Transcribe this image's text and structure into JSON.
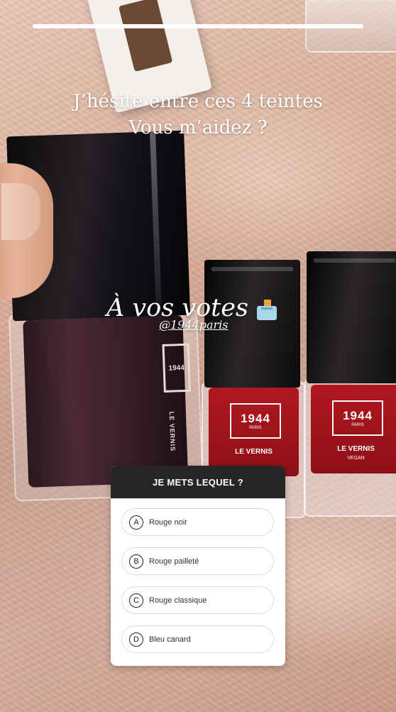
{
  "story": {
    "progress": 1.0,
    "caption_lines": [
      "J’hésite entre ces 4 teintes",
      "Vous m’aidez ?"
    ],
    "vote_text": "À vos votes",
    "vote_emoji": "ballot-box-icon",
    "mention": "@1944paris"
  },
  "products": {
    "big_bottle_logo": "1944",
    "big_bottle_label": "LE VERNIS",
    "red_bottles": [
      {
        "logo": "1944",
        "logo_sub": "PARIS",
        "label": "LE VERNIS",
        "label_sub": ""
      },
      {
        "logo": "1944",
        "logo_sub": "PARIS",
        "label": "LE VERNIS",
        "label_sub": "VEGAN"
      }
    ]
  },
  "poll": {
    "question": "JE METS LEQUEL ?",
    "options": [
      {
        "letter": "A",
        "label": "Rouge noir"
      },
      {
        "letter": "B",
        "label": "Rouge pailleté"
      },
      {
        "letter": "C",
        "label": "Rouge classique"
      },
      {
        "letter": "D",
        "label": "Bleu canard"
      }
    ]
  },
  "colors": {
    "polish_red": "#a3131b",
    "dark_polish": "#3a202a",
    "poll_header_bg": "#262626"
  }
}
